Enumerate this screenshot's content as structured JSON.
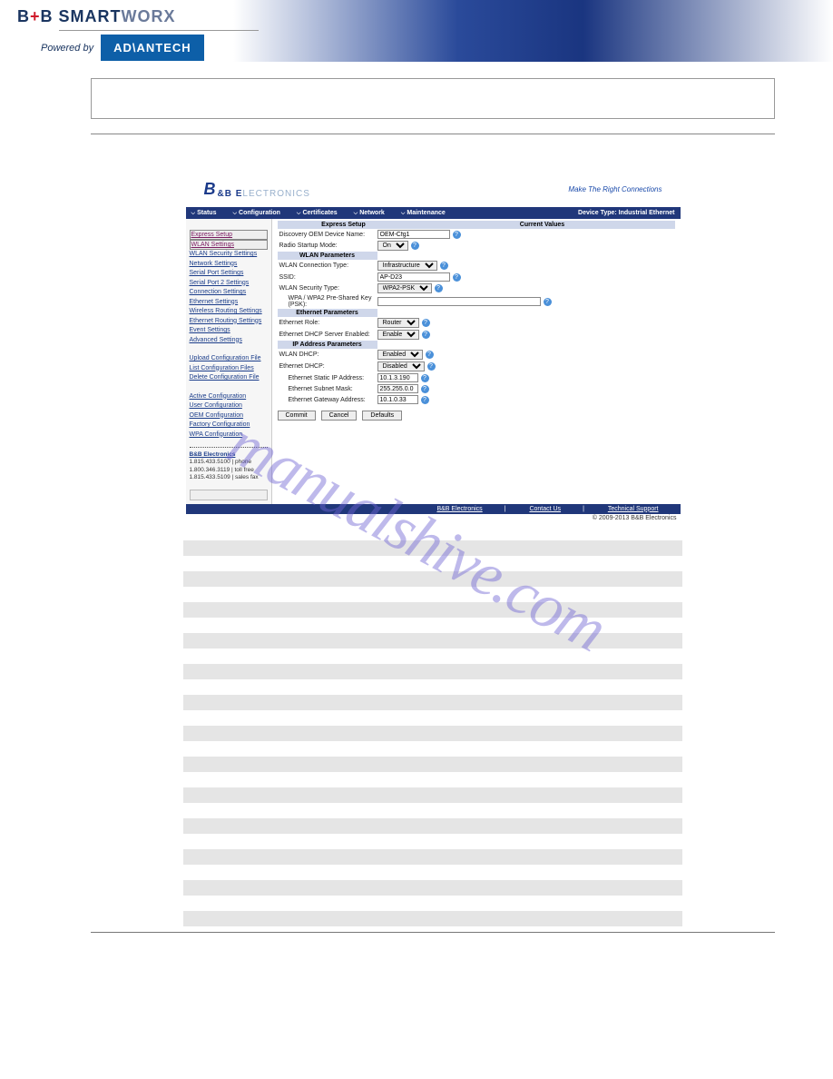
{
  "brand": {
    "text": "B+B SMARTWORX",
    "powered": "Powered by",
    "adv": "AD\\ANTECH"
  },
  "shot": {
    "logo": {
      "b": "B",
      "rest": "&B ",
      "el": "E",
      "lect": "LECTRONICS"
    },
    "tagline": "Make The Right Connections",
    "nav": [
      "Status",
      "Configuration",
      "Certificates",
      "Network",
      "Maintenance"
    ],
    "device_type": "Device Type: Industrial Ethernet",
    "sidebar": {
      "links1": [
        "Express Setup",
        "WLAN Settings",
        "WLAN Security Settings",
        "Network Settings",
        "Serial Port Settings",
        "Serial Port 2 Settings",
        "Connection Settings",
        "Ethernet Settings",
        "Wireless Routing Settings",
        "Ethernet Routing Settings",
        "Event Settings",
        "Advanced Settings"
      ],
      "links2": [
        "Upload Configuration File",
        "List Configuration Files",
        "Delete Configuration File"
      ],
      "links3": [
        "Active Configuration",
        "User Configuration",
        "OEM Configuration",
        "Factory Configuration",
        "WPA Configuration"
      ],
      "contact": {
        "name": "B&B Electronics",
        "p1": "1.815.433.5100 |  phone",
        "p2": "1.800.346.3119 |  toll free",
        "p3": "1.815.433.5109 |  sales fax"
      }
    },
    "sec_express": "Express Setup",
    "sec_current": "Current Values",
    "rows": {
      "dev_name_lbl": "Discovery OEM Device Name:",
      "dev_name_val": "OEM-Cfg1",
      "radio_lbl": "Radio Startup Mode:",
      "radio_val": "On",
      "wlan_params": "WLAN Parameters",
      "conn_type_lbl": "WLAN Connection Type:",
      "conn_type_val": "Infrastructure",
      "ssid_lbl": "SSID:",
      "ssid_val": "AP-D23",
      "sec_type_lbl": "WLAN Security Type:",
      "sec_type_val": "WPA2-PSK",
      "psk_lbl": "WPA / WPA2 Pre-Shared Key (PSK):",
      "eth_params": "Ethernet Parameters",
      "eth_role_lbl": "Ethernet Role:",
      "eth_role_val": "Router",
      "dhcp_srv_lbl": "Ethernet DHCP Server Enabled:",
      "dhcp_srv_val": "Enable",
      "ip_params": "IP Address Parameters",
      "wlan_dhcp_lbl": "WLAN DHCP:",
      "wlan_dhcp_val": "Enabled",
      "eth_dhcp_lbl": "Ethernet DHCP:",
      "eth_dhcp_val": "Disabled",
      "eth_ip_lbl": "Ethernet Static IP Address:",
      "eth_ip_val": "10.1.3.190",
      "eth_mask_lbl": "Ethernet Subnet Mask:",
      "eth_mask_val": "255.255.0.0",
      "eth_gw_lbl": "Ethernet Gateway Address:",
      "eth_gw_val": "10.1.0.33"
    },
    "btns": {
      "commit": "Commit",
      "cancel": "Cancel",
      "defaults": "Defaults"
    },
    "footer": {
      "bb": "B&B Electronics",
      "contact": "Contact Us",
      "support": "Technical Support"
    },
    "copy": "© 2009-2013 B&B Electronics"
  },
  "watermark": "manualshive.com"
}
